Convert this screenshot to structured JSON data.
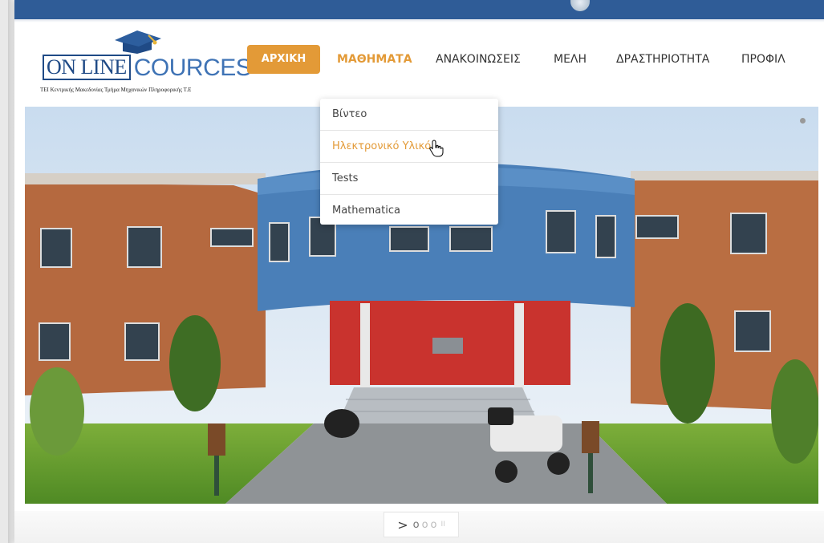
{
  "logo": {
    "online_text": "ON LINE",
    "cources_text": "COURCES",
    "tagline": "ΤΕΙ Κεντρικής Μακεδονίας Τμήμα Μηχανικών Πληροφορικής Τ.Ε"
  },
  "nav": {
    "items": [
      {
        "label": "ΑΡΧΙΚΗ"
      },
      {
        "label": "ΜΑΘΗΜΑΤΑ"
      },
      {
        "label": "ΑΝΑΚΟΙΝΩΣΕΙΣ"
      },
      {
        "label": "ΜΕΛΗ"
      },
      {
        "label": "ΔΡΑΣΤΗΡΙΟΤΗΤΑ"
      },
      {
        "label": "ΠΡΟΦΙΛ"
      }
    ]
  },
  "dropdown": {
    "items": [
      {
        "label": "Βίντεο"
      },
      {
        "label": "Ηλεκτρονικό Υλικό"
      },
      {
        "label": "Tests"
      },
      {
        "label": "Mathematica"
      }
    ]
  },
  "pager": {
    "next": ">",
    "pages": [
      "o",
      "o",
      "o"
    ],
    "pause": "II"
  },
  "colors": {
    "topbar": "#2f5c97",
    "accent": "#e39a37",
    "logo_blue": "#1f4a86"
  }
}
